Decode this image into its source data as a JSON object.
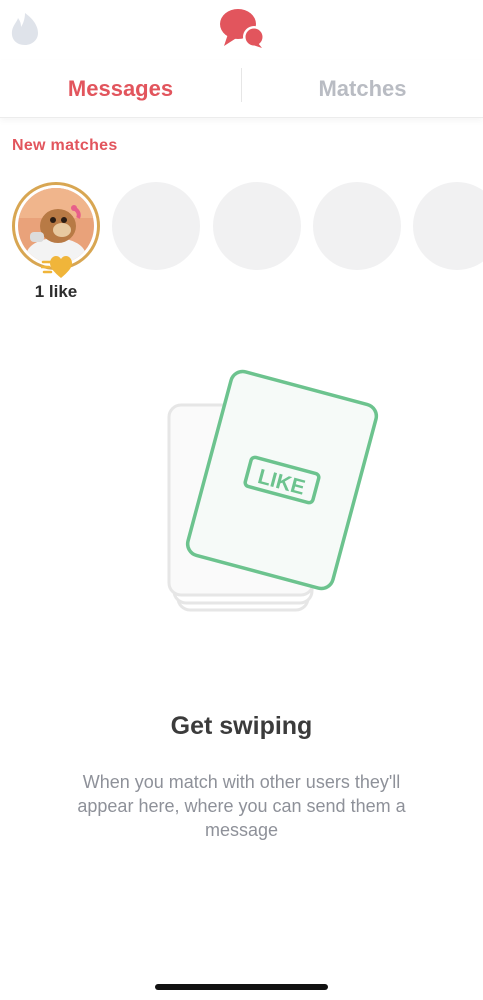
{
  "header": {
    "left_icon": "flame-icon",
    "center_icon": "chat-bubbles-icon"
  },
  "tabs": [
    {
      "label": "Messages",
      "active": true
    },
    {
      "label": "Matches",
      "active": false
    }
  ],
  "new_matches": {
    "title": "New matches",
    "likes_item": {
      "label": "1 like",
      "icon": "gold-heart-icon"
    },
    "placeholder_count": 4
  },
  "empty_state": {
    "card_stamp": "LIKE",
    "title": "Get swiping",
    "body": "When you match with other users they'll appear here, where you can send them a message"
  },
  "colors": {
    "accent": "#e2555d",
    "inactive_tab": "#b9bcc3",
    "like_green": "#6cc38e",
    "gold": "#d8a652"
  }
}
